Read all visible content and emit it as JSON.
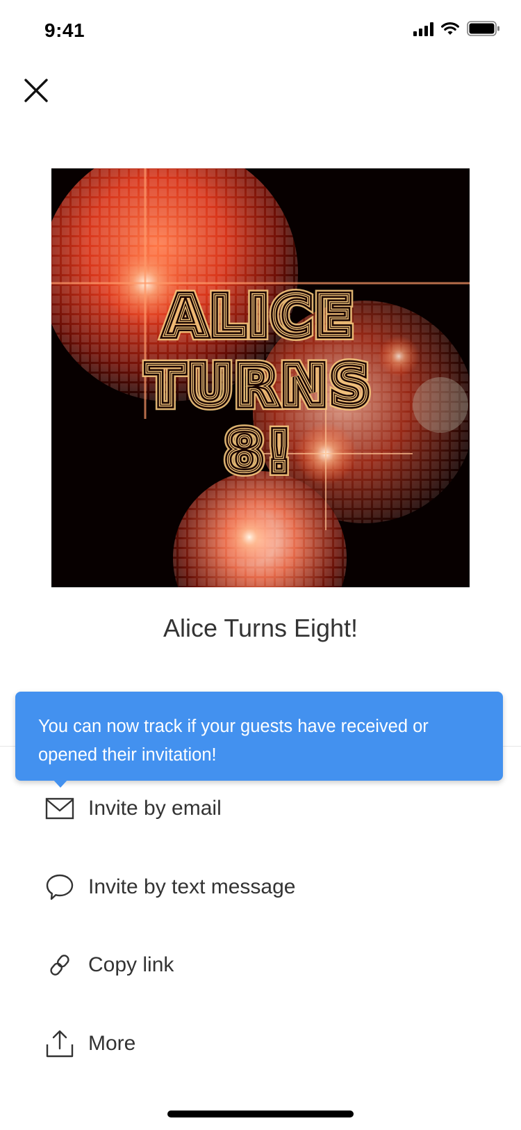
{
  "status_bar": {
    "time": "9:41"
  },
  "event": {
    "title": "Alice Turns Eight!"
  },
  "invite_card": {
    "headline_lines": [
      "ALICE",
      "TURNS",
      "8!"
    ],
    "theme": "disco-ball"
  },
  "tooltip": {
    "text": "You can now track if your guests have received or opened their invitation!"
  },
  "options": [
    {
      "label": "Invite by email",
      "icon": "mail-icon"
    },
    {
      "label": "Invite by text message",
      "icon": "chat-bubble-icon"
    },
    {
      "label": "Copy link",
      "icon": "link-icon"
    },
    {
      "label": "More",
      "icon": "share-icon"
    }
  ],
  "colors": {
    "tooltip_bg": "#4391ef",
    "accent_text": "#333333"
  }
}
